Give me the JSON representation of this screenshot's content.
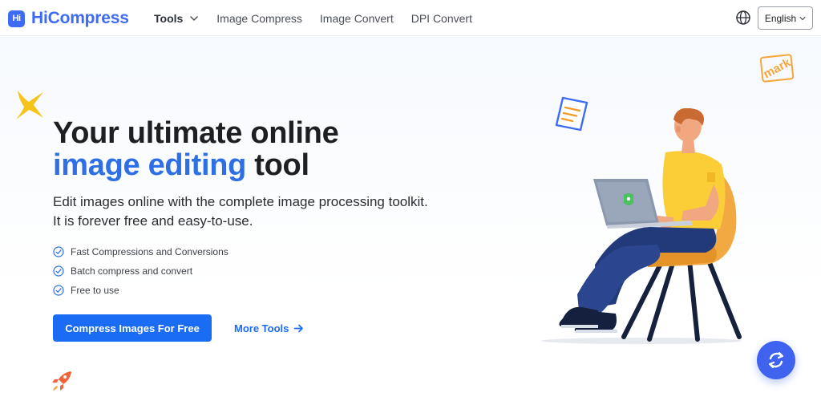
{
  "header": {
    "logo_mark": "Hi",
    "logo_text": "HiCompress",
    "nav": {
      "tools": "Tools",
      "image_compress": "Image Compress",
      "image_convert": "Image Convert",
      "dpi_convert": "DPI Convert"
    },
    "language": "English"
  },
  "hero": {
    "title_line1": "Your ultimate online",
    "title_accent": "image editing",
    "title_rest": " tool",
    "subtitle_line1": "Edit images online with the complete image processing toolkit.",
    "subtitle_line2": "It is forever free and easy-to-use.",
    "features": [
      "Fast Compressions and Conversions",
      "Batch compress and convert",
      "Free to use"
    ],
    "primary_button": "Compress Images For Free",
    "secondary_link": "More Tools"
  },
  "decor": {
    "mark_text": "mark"
  },
  "colors": {
    "brand": "#3d6bf5",
    "accent": "#2f6fe6",
    "button": "#1a6cf5",
    "fab": "#3f63ef"
  },
  "icons": {
    "globe": "globe-icon",
    "chevron": "chevron-down-icon",
    "check": "check-circle-icon",
    "arrow": "arrow-right-icon",
    "refresh": "refresh-icon"
  }
}
